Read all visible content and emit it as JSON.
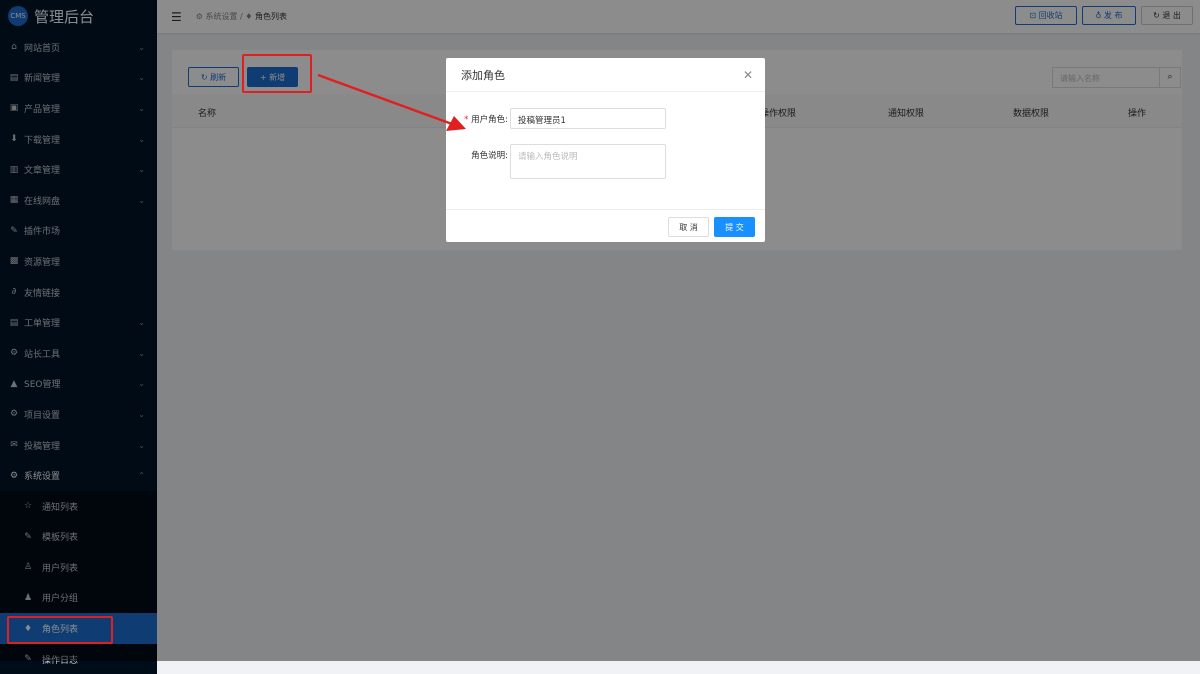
{
  "app": {
    "logo_badge": "CMS",
    "title": "管理后台"
  },
  "sidebar": {
    "items": [
      {
        "icon": "home-icon",
        "glyph": "⌂",
        "label": "网站首页",
        "expand": true
      },
      {
        "icon": "news-icon",
        "glyph": "▤",
        "label": "新闻管理",
        "expand": true
      },
      {
        "icon": "product-icon",
        "glyph": "▣",
        "label": "产品管理",
        "expand": true
      },
      {
        "icon": "download-icon",
        "glyph": "⬇",
        "label": "下载管理",
        "expand": true
      },
      {
        "icon": "article-icon",
        "glyph": "▥",
        "label": "文章管理",
        "expand": true
      },
      {
        "icon": "disk-icon",
        "glyph": "▦",
        "label": "在线网盘",
        "expand": true
      },
      {
        "icon": "plugin-icon",
        "glyph": "✎",
        "label": "插件市场",
        "expand": false
      },
      {
        "icon": "resource-icon",
        "glyph": "▩",
        "label": "资源管理",
        "expand": false
      },
      {
        "icon": "link-icon",
        "glyph": "∂",
        "label": "友情链接",
        "expand": false
      },
      {
        "icon": "ticket-icon",
        "glyph": "▤",
        "label": "工单管理",
        "expand": true
      },
      {
        "icon": "tools-icon",
        "glyph": "⚙",
        "label": "站长工具",
        "expand": true
      },
      {
        "icon": "seo-icon",
        "glyph": "▲",
        "label": "SEO管理",
        "expand": true
      },
      {
        "icon": "project-settings-icon",
        "glyph": "⚙",
        "label": "项目设置",
        "expand": true
      },
      {
        "icon": "submission-icon",
        "glyph": "✉",
        "label": "投稿管理",
        "expand": true
      }
    ],
    "open_group": {
      "icon": "settings-icon",
      "glyph": "⚙",
      "label": "系统设置"
    },
    "sub_items": [
      {
        "icon": "star-icon",
        "glyph": "☆",
        "label": "通知列表"
      },
      {
        "icon": "pin-icon",
        "glyph": "✎",
        "label": "模板列表"
      },
      {
        "icon": "user-icon",
        "glyph": "♙",
        "label": "用户列表"
      },
      {
        "icon": "group-icon",
        "glyph": "♟",
        "label": "用户分组"
      },
      {
        "icon": "role-icon",
        "glyph": "♦",
        "label": "角色列表",
        "active": true
      },
      {
        "icon": "log-icon",
        "glyph": "✎",
        "label": "操作日志"
      }
    ]
  },
  "header": {
    "breadcrumb": [
      "系统设置",
      "角色列表"
    ],
    "recycle": "回收站",
    "publish": "发 布",
    "logout": "退 出"
  },
  "toolbar": {
    "refresh": "刷新",
    "add": "新增",
    "search_placeholder": "请输入名称"
  },
  "table": {
    "columns": [
      "名称",
      "操作权限",
      "通知权限",
      "数据权限",
      "操作"
    ]
  },
  "dialog": {
    "title": "添加角色",
    "role_label": "用户角色:",
    "role_value": "投稿管理员1",
    "desc_label": "角色说明:",
    "desc_placeholder": "请输入角色说明",
    "cancel": "取 消",
    "submit": "提 交"
  },
  "colors": {
    "primary": "#1c6fd1",
    "sidebar": "#001529",
    "annotation": "#e02020"
  }
}
